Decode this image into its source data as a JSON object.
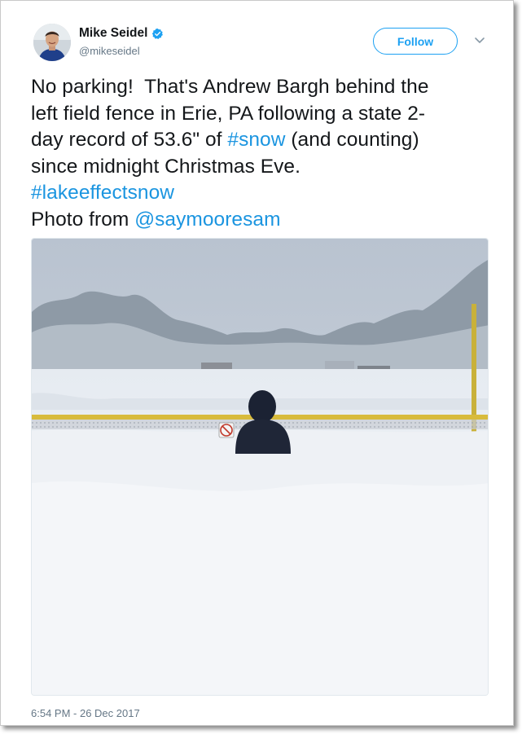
{
  "user": {
    "display_name": "Mike Seidel",
    "handle": "@mikeseidel",
    "verified": true,
    "verified_icon": "verified-badge-icon"
  },
  "actions": {
    "follow_label": "Follow",
    "more_icon": "chevron-down-icon"
  },
  "tweet": {
    "line1": "No parking!  That's Andrew Bargh behind the",
    "line2": "left field fence in Erie, PA following a state 2-",
    "line3_a": "day record of 53.6\" of ",
    "line3_link": "#snow",
    "line3_b": " (and counting)",
    "line4": "since midnight Christmas Eve.",
    "hashtag": "#lakeeffectsnow",
    "credit_prefix": "Photo from ",
    "credit_mention": "@saymooresam"
  },
  "photo": {
    "subject": "person-in-snow-photo"
  },
  "timestamp": "6:54 PM - 26 Dec 2017",
  "colors": {
    "link": "#1b95e0",
    "follow": "#1da1f2",
    "verified": "#1da1f2",
    "text": "#14171a",
    "secondary": "#657786"
  }
}
